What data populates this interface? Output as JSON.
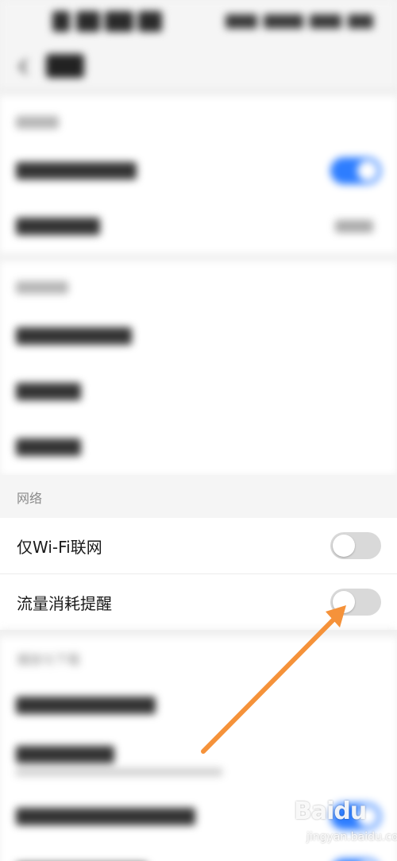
{
  "network_section": {
    "header": "网络",
    "rows": [
      {
        "label": "仅Wi-Fi联网",
        "enabled": false
      },
      {
        "label": "流量消耗提醒",
        "enabled": false
      }
    ]
  },
  "blurred_section_below": {
    "header": "播放与下载"
  },
  "watermark": {
    "brand": "Baidu",
    "sub": "jingyan.baidu.com"
  },
  "colors": {
    "accent_blue": "#2d7dff",
    "toggle_off": "#d9d9d9",
    "annotation_arrow": "#f5923a"
  },
  "icons": {
    "back": "chevron-left-icon"
  }
}
